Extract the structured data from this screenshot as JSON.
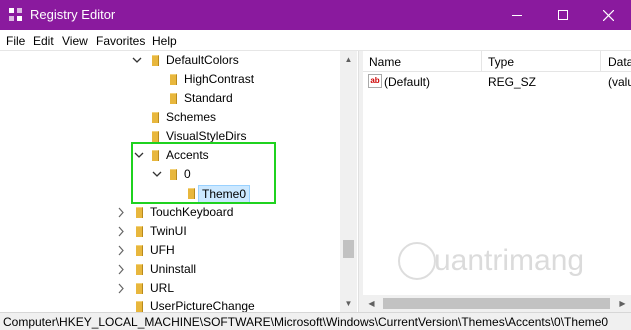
{
  "window": {
    "title": "Registry Editor",
    "titlebar_color": "#8a1a9e"
  },
  "menu": [
    "File",
    "Edit",
    "View",
    "Favorites",
    "Help"
  ],
  "tree": {
    "nodes": [
      {
        "label": "DefaultColors",
        "expanded": true
      },
      {
        "label": "HighContrast"
      },
      {
        "label": "Standard"
      },
      {
        "label": "Schemes"
      },
      {
        "label": "VisualStyleDirs"
      },
      {
        "label": "Accents",
        "expanded": true
      },
      {
        "label": "0",
        "expanded": true
      },
      {
        "label": "Theme0",
        "selected": true
      },
      {
        "label": "TouchKeyboard"
      },
      {
        "label": "TwinUI"
      },
      {
        "label": "UFH"
      },
      {
        "label": "Uninstall"
      },
      {
        "label": "URL"
      },
      {
        "label": "UserPictureChange"
      }
    ],
    "highlight_color": "#1fd21f"
  },
  "list": {
    "columns": [
      "Name",
      "Type",
      "Data"
    ],
    "rows": [
      {
        "name": "(Default)",
        "type": "REG_SZ",
        "data": "(valu"
      }
    ]
  },
  "watermark": "uantrimang",
  "status": {
    "path": "Computer\\HKEY_LOCAL_MACHINE\\SOFTWARE\\Microsoft\\Windows\\CurrentVersion\\Themes\\Accents\\0\\Theme0"
  }
}
